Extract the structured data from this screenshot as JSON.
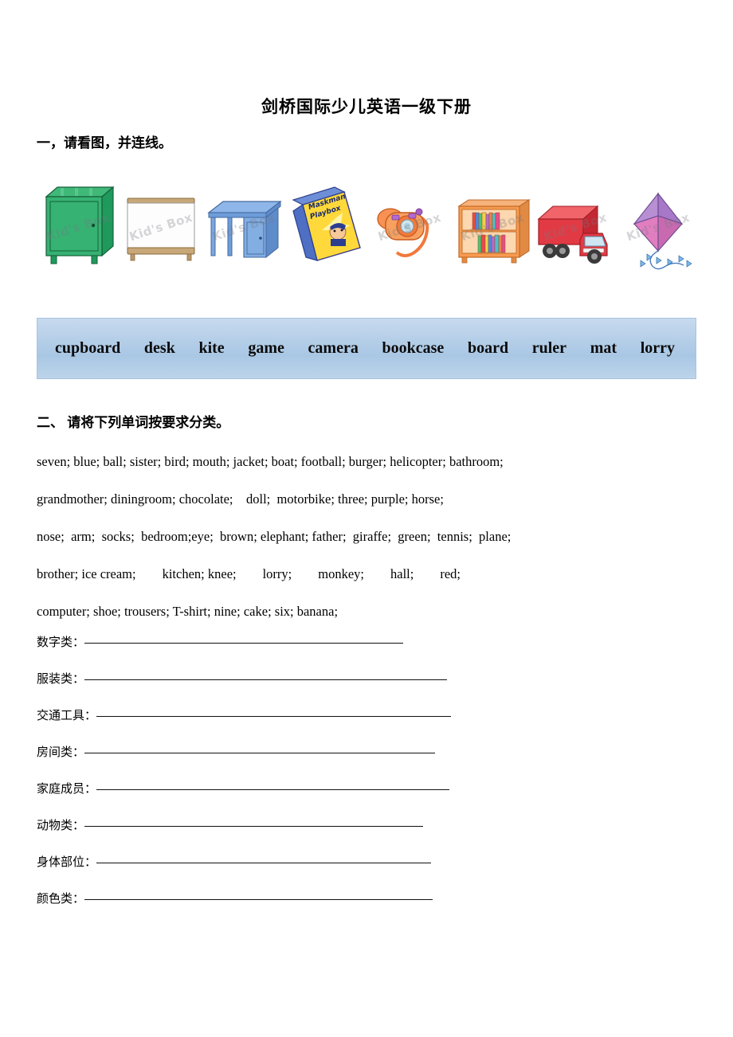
{
  "document": {
    "title": "剑桥国际少儿英语一级下册"
  },
  "section1": {
    "heading": "一，请看图，并连线。",
    "pictures": [
      {
        "name": "cupboard-image",
        "label": "cupboard",
        "watermark": "Kid's Box"
      },
      {
        "name": "board-image",
        "label": "board",
        "watermark": "Kid's Box"
      },
      {
        "name": "desk-image",
        "label": "desk",
        "watermark": "Kid's Box"
      },
      {
        "name": "game-image",
        "label": "game",
        "watermark": "Maskman Playbox"
      },
      {
        "name": "camera-image",
        "label": "camera",
        "watermark": "Kid's Box"
      },
      {
        "name": "bookcase-image",
        "label": "bookcase",
        "watermark": "Kid's Box"
      },
      {
        "name": "lorry-image",
        "label": "lorry",
        "watermark": "Kid's Box"
      },
      {
        "name": "kite-image",
        "label": "kite",
        "watermark": "Kid's Box"
      }
    ],
    "wordbank": [
      "cupboard",
      "desk",
      "kite",
      "game",
      "camera",
      "bookcase",
      "board",
      "ruler",
      "mat",
      "lorry"
    ],
    "wordbank_colors": {
      "fill_top": "#c7daee",
      "fill_mid": "#a9c7e4",
      "border": "#a9c3de"
    }
  },
  "section2": {
    "heading": "二、 请将下列单词按要求分类。",
    "word_lines": [
      "seven; blue; ball; sister; bird; mouth; jacket; boat; football; burger; helicopter; bathroom;",
      "grandmother; diningroom; chocolate;    doll;  motorbike; three; purple; horse;",
      "nose;  arm;  socks;  bedroom;eye;  brown; elephant; father;  giraffe;  green;  tennis;  plane;",
      "brother; ice cream;        kitchen; knee;        lorry;        monkey;        hall;        red;",
      "computer; shoe; trousers; T-shirt; nine; cake; six; banana;"
    ],
    "categories": [
      {
        "label": "数字类：",
        "rule_width": 400
      },
      {
        "label": "服装类：",
        "rule_width": 455
      },
      {
        "label": "交通工具：",
        "rule_width": 445
      },
      {
        "label": "房间类：",
        "rule_width": 440
      },
      {
        "label": "家庭成员：",
        "rule_width": 443
      },
      {
        "label": "动物类：",
        "rule_width": 425
      },
      {
        "label": "身体部位：",
        "rule_width": 420
      },
      {
        "label": "颜色类：",
        "rule_width": 437
      }
    ]
  }
}
